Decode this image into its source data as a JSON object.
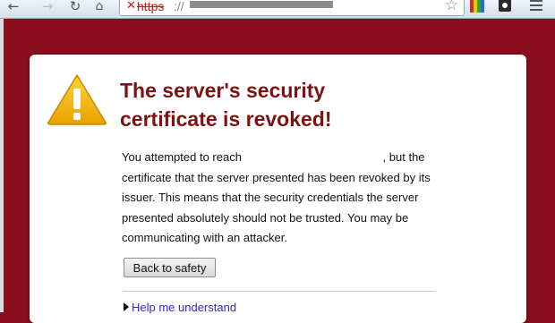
{
  "toolbar": {
    "icons": {
      "back": "back-arrow-icon",
      "forward": "forward-arrow-icon",
      "reload": "reload-icon",
      "home": "home-icon",
      "star": "star-icon",
      "extension": "extension-icon",
      "puzzle": "puzzle-icon",
      "menu": "menu-icon"
    }
  },
  "omnibox": {
    "scheme": "https",
    "separator": "://"
  },
  "page": {
    "title": "The server's security certificate is revoked!",
    "message_before": "You attempted to reach ",
    "message_after": ", but the certificate that the server presented has been revoked by its issuer. This means that the security credentials the server presented absolutely should not be trusted. You may be communicating with an attacker.",
    "button_label": "Back to safety",
    "help_link": "Help me understand"
  },
  "colors": {
    "background": "#8b0e1e",
    "title": "#7e1212",
    "link": "#2929d1",
    "warning": "#f2b400"
  }
}
